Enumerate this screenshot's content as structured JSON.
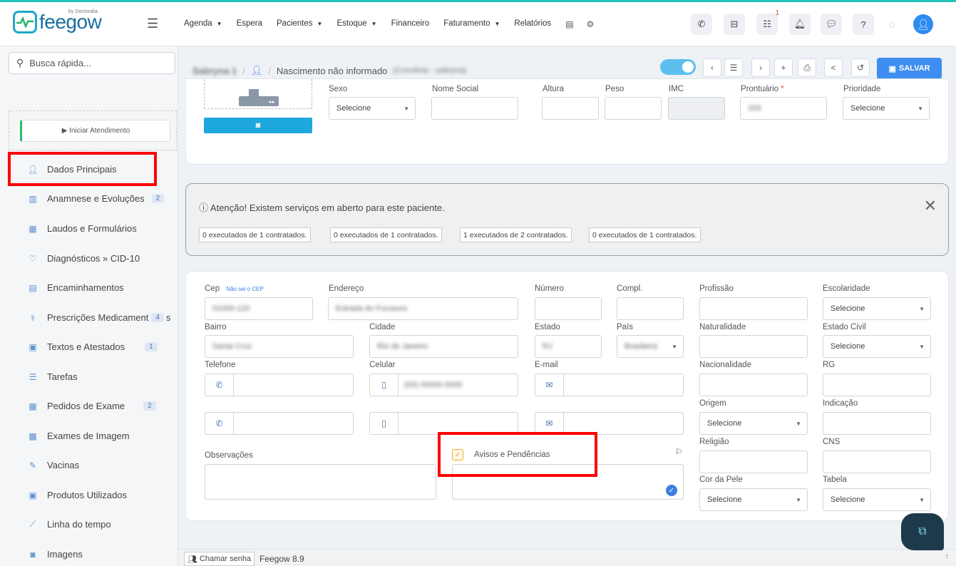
{
  "brand": {
    "name": "feegow",
    "by": "by Doctoralia"
  },
  "topmenu": [
    {
      "label": "Agenda",
      "caret": true
    },
    {
      "label": "Espera",
      "caret": false
    },
    {
      "label": "Pacientes",
      "caret": true
    },
    {
      "label": "Estoque",
      "caret": true
    },
    {
      "label": "Financeiro",
      "caret": false
    },
    {
      "label": "Faturamento",
      "caret": true
    },
    {
      "label": "Relatórios",
      "caret": false
    }
  ],
  "notification_badge": "1",
  "search": {
    "placeholder": "Busca rápida..."
  },
  "start_button": "▶ Iniciar Atendimento",
  "sidebar": [
    {
      "label": "Dados Principais",
      "icon": "user-icon",
      "badge": ""
    },
    {
      "label": "Anamnese e Evoluções",
      "icon": "chart-icon",
      "badge": "2"
    },
    {
      "label": "Laudos e Formulários",
      "icon": "calendar-icon",
      "badge": ""
    },
    {
      "label": "Diagnósticos » CID-10",
      "icon": "stethoscope-icon",
      "badge": ""
    },
    {
      "label": "Encaminhamentos",
      "icon": "document-icon",
      "badge": ""
    },
    {
      "label": "Prescrições Medicament",
      "icon": "pills-icon",
      "badge": "4"
    },
    {
      "label": "Textos e Atestados",
      "icon": "file-text-icon",
      "badge": "1"
    },
    {
      "label": "Tarefas",
      "icon": "list-icon",
      "badge": ""
    },
    {
      "label": "Pedidos de Exame",
      "icon": "calendar-icon",
      "badge": "2"
    },
    {
      "label": "Exames de Imagem",
      "icon": "image-icon",
      "badge": ""
    },
    {
      "label": "Vacinas",
      "icon": "syringe-icon",
      "badge": ""
    },
    {
      "label": "Produtos Utilizados",
      "icon": "box-icon",
      "badge": ""
    },
    {
      "label": "Linha do tempo",
      "icon": "timeline-icon",
      "badge": ""
    },
    {
      "label": "Imagens",
      "icon": "camera-icon",
      "badge": ""
    }
  ],
  "header": {
    "patient_name": "Sabryna 1",
    "birth": "Nascimento não informado",
    "convenio": "(Convênio - sabryna)",
    "save": "SALVAR"
  },
  "top_card": {
    "labels": {
      "sexo": "Sexo",
      "nome_social": "Nome Social",
      "altura": "Altura",
      "peso": "Peso",
      "imc": "IMC",
      "prontuario": "Prontuário",
      "required_mark": "*",
      "prioridade": "Prioridade"
    },
    "sexo_value": "Selecione",
    "prontuario_value": "333",
    "prioridade_value": "Selecione"
  },
  "alert": {
    "strong": "Atenção!",
    "message": "Existem serviços em aberto para este paciente.",
    "pills": [
      "0 executados de 1 contratados.",
      "0 executados de 1 contratados.",
      "1 executados de 2 contratados.",
      "0 executados de 1 contratados."
    ]
  },
  "address_card": {
    "labels": {
      "cep": "Cep",
      "cep_link": "Não sei o CEP",
      "endereco": "Endereço",
      "numero": "Número",
      "compl": "Compl.",
      "profissao": "Profissão",
      "escolaridade": "Escolaridade",
      "bairro": "Bairro",
      "cidade": "Cidade",
      "estado": "Estado",
      "pais": "País",
      "naturalidade": "Naturalidade",
      "estado_civil": "Estado Civil",
      "telefone": "Telefone",
      "celular": "Celular",
      "email": "E-mail",
      "nacionalidade": "Nacionalidade",
      "rg": "RG",
      "origem": "Origem",
      "indicacao": "Indicação",
      "observacoes": "Observações",
      "avisos": "Avisos e Pendências",
      "religiao": "Religião",
      "cns": "CNS",
      "cor_pele": "Cor da Pele",
      "tabela": "Tabela"
    },
    "values": {
      "cep": "01000-120",
      "endereco": "Estrada do Furusuro",
      "bairro": "Santa Cruz",
      "cidade": "Rio de Janeiro",
      "estado": "RJ",
      "pais": "Brasileira",
      "celular": "(00) 00000-0000",
      "select": "Selecione"
    }
  },
  "bottom": {
    "chamar": "Chamar senha",
    "version": "Feegow 8.9"
  }
}
